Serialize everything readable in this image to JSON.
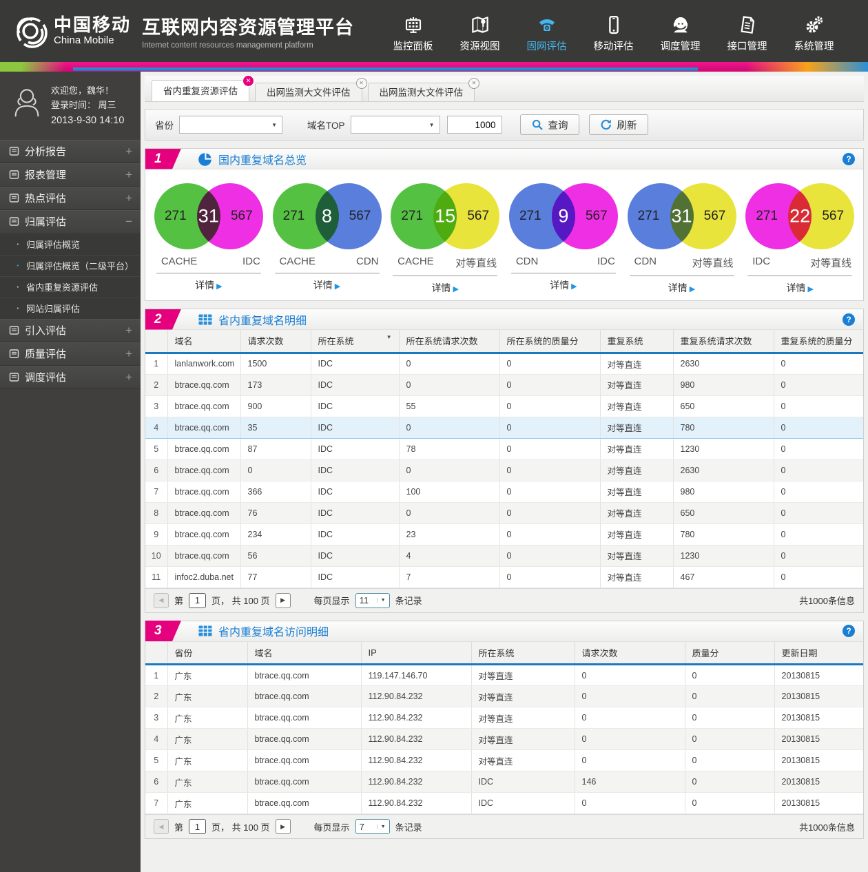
{
  "ui": {
    "help": "?",
    "plus": "+",
    "minus": "−",
    "dot": "·",
    "detail_arrow": "▶",
    "close": "✕",
    "caret": "▼",
    "prev": "◀",
    "next": "▶"
  },
  "colors": {
    "accent_pink": "#e5007d",
    "link_blue": "#1a7fd4",
    "nav_active": "#45b6ef",
    "table_header_line": "#1879c0",
    "selected_row_bg": "#e3f1fb"
  },
  "header": {
    "brand_cn": "中国移动",
    "brand_en": "China Mobile",
    "title": "互联网内容资源管理平台",
    "subtitle": "Internet content resources management platform",
    "nav": [
      {
        "label": "监控面板",
        "icon": "dashboard-icon",
        "active": false
      },
      {
        "label": "资源视图",
        "icon": "map-icon",
        "active": false
      },
      {
        "label": "固网评估",
        "icon": "telephone-icon",
        "active": true
      },
      {
        "label": "移动评估",
        "icon": "mobile-icon",
        "active": false
      },
      {
        "label": "调度管理",
        "icon": "dispatcher-icon",
        "active": false
      },
      {
        "label": "接口管理",
        "icon": "interface-icon",
        "active": false
      },
      {
        "label": "系统管理",
        "icon": "gears-icon",
        "active": false
      }
    ]
  },
  "sidebar": {
    "welcome": "欢迎您，魏华！",
    "login_line1": "登录时间：  周三",
    "login_line2": "2013-9-30   14:10",
    "menu": [
      {
        "label": "分析报告",
        "expanded": false
      },
      {
        "label": "报表管理",
        "expanded": false
      },
      {
        "label": "热点评估",
        "expanded": false
      },
      {
        "label": "归属评估",
        "expanded": true,
        "children": [
          {
            "label": "归属评估概览",
            "dot_color": "#c0c0be"
          },
          {
            "label": "归属评估概览（二级平台）",
            "dot_color": "#3fa7e8"
          },
          {
            "label": "省内重复资源评估",
            "dot_color": "#c0c0be"
          },
          {
            "label": "网站归属评估",
            "dot_color": "#c0c0be"
          }
        ]
      },
      {
        "label": "引入评估",
        "expanded": false
      },
      {
        "label": "质量评估",
        "expanded": false
      },
      {
        "label": "调度评估",
        "expanded": false
      }
    ]
  },
  "tabs": [
    {
      "label": "省内重复资源评估",
      "active": true
    },
    {
      "label": "出网监测大文件评估",
      "active": false
    },
    {
      "label": "出网监测大文件评估",
      "active": false
    }
  ],
  "filter": {
    "province_label": "省份",
    "domain_top_label": "域名TOP",
    "top_value": "1000",
    "query_label": "查询",
    "refresh_label": "刷新"
  },
  "sections": {
    "overview": {
      "number": "1",
      "title": "国内重复域名总览",
      "detail_label": "详情",
      "venns": [
        {
          "left": {
            "label": "CACHE",
            "value": "271",
            "color": "#55c143"
          },
          "overlap": "31",
          "right": {
            "label": "IDC",
            "value": "567",
            "color": "#ef2fe3"
          }
        },
        {
          "left": {
            "label": "CACHE",
            "value": "271",
            "color": "#55c143"
          },
          "overlap": "8",
          "right": {
            "label": "CDN",
            "value": "567",
            "color": "#5a7edb"
          }
        },
        {
          "left": {
            "label": "CACHE",
            "value": "271",
            "color": "#55c143"
          },
          "overlap": "15",
          "right": {
            "label": "对等直线",
            "value": "567",
            "color": "#e9e43c"
          }
        },
        {
          "left": {
            "label": "CDN",
            "value": "271",
            "color": "#5a7edb"
          },
          "overlap": "9",
          "right": {
            "label": "IDC",
            "value": "567",
            "color": "#ef2fe3"
          }
        },
        {
          "left": {
            "label": "CDN",
            "value": "271",
            "color": "#5a7edb"
          },
          "overlap": "31",
          "right": {
            "label": "对等直线",
            "value": "567",
            "color": "#e9e43c"
          }
        },
        {
          "left": {
            "label": "IDC",
            "value": "271",
            "color": "#ef2fe3"
          },
          "overlap": "22",
          "right": {
            "label": "对等直线",
            "value": "567",
            "color": "#e9e43c"
          }
        }
      ]
    },
    "domain_detail": {
      "number": "2",
      "title": "省内重复域名明细",
      "columns": [
        "域名",
        "请求次数",
        "所在系统",
        "所在系统请求次数",
        "所在系统的质量分",
        "重复系统",
        "重复系统请求次数",
        "重复系统的质量分"
      ],
      "sortable_column_index": 2,
      "selected_row_number": 4,
      "rows": [
        [
          "lanlanwork.com",
          "1500",
          "IDC",
          "0",
          "0",
          "对等直连",
          "2630",
          "0"
        ],
        [
          "btrace.qq.com",
          "173",
          "IDC",
          "0",
          "0",
          "对等直连",
          "980",
          "0"
        ],
        [
          "btrace.qq.com",
          "900",
          "IDC",
          "55",
          "0",
          "对等直连",
          "650",
          "0"
        ],
        [
          "btrace.qq.com",
          "35",
          "IDC",
          "0",
          "0",
          "对等直连",
          "780",
          "0"
        ],
        [
          "btrace.qq.com",
          "87",
          "IDC",
          "78",
          "0",
          "对等直连",
          "1230",
          "0"
        ],
        [
          "btrace.qq.com",
          "0",
          "IDC",
          "0",
          "0",
          "对等直连",
          "2630",
          "0"
        ],
        [
          "btrace.qq.com",
          "366",
          "IDC",
          "100",
          "0",
          "对等直连",
          "980",
          "0"
        ],
        [
          "btrace.qq.com",
          "76",
          "IDC",
          "0",
          "0",
          "对等直连",
          "650",
          "0"
        ],
        [
          "btrace.qq.com",
          "234",
          "IDC",
          "23",
          "0",
          "对等直连",
          "780",
          "0"
        ],
        [
          "btrace.qq.com",
          "56",
          "IDC",
          "4",
          "0",
          "对等直连",
          "1230",
          "0"
        ],
        [
          "infoc2.duba.net",
          "77",
          "IDC",
          "7",
          "0",
          "对等直连",
          "467",
          "0"
        ]
      ],
      "pagination": {
        "page_prefix": "第",
        "page": "1",
        "page_suffix": "页，  共 100 页",
        "per_page_label": "每页显示",
        "per_page": "11",
        "per_page_suffix": "条记录",
        "total": "共1000条信息"
      }
    },
    "access_detail": {
      "number": "3",
      "title": "省内重复域名访问明细",
      "columns": [
        "省份",
        "域名",
        "IP",
        "所在系统",
        "请求次数",
        "质量分",
        "更新日期"
      ],
      "rows": [
        [
          "广东",
          "btrace.qq.com",
          "119.147.146.70",
          "对等直连",
          "0",
          "0",
          "20130815"
        ],
        [
          "广东",
          "btrace.qq.com",
          "112.90.84.232",
          "对等直连",
          "0",
          "0",
          "20130815"
        ],
        [
          "广东",
          "btrace.qq.com",
          "112.90.84.232",
          "对等直连",
          "0",
          "0",
          "20130815"
        ],
        [
          "广东",
          "btrace.qq.com",
          "112.90.84.232",
          "对等直连",
          "0",
          "0",
          "20130815"
        ],
        [
          "广东",
          "btrace.qq.com",
          "112.90.84.232",
          "对等直连",
          "0",
          "0",
          "20130815"
        ],
        [
          "广东",
          "btrace.qq.com",
          "112.90.84.232",
          "IDC",
          "146",
          "0",
          "20130815"
        ],
        [
          "广东",
          "btrace.qq.com",
          "112.90.84.232",
          "IDC",
          "0",
          "0",
          "20130815"
        ]
      ],
      "pagination": {
        "page_prefix": "第",
        "page": "1",
        "page_suffix": "页，  共 100 页",
        "per_page_label": "每页显示",
        "per_page": "7",
        "per_page_suffix": "条记录",
        "total": "共1000条信息"
      }
    }
  }
}
